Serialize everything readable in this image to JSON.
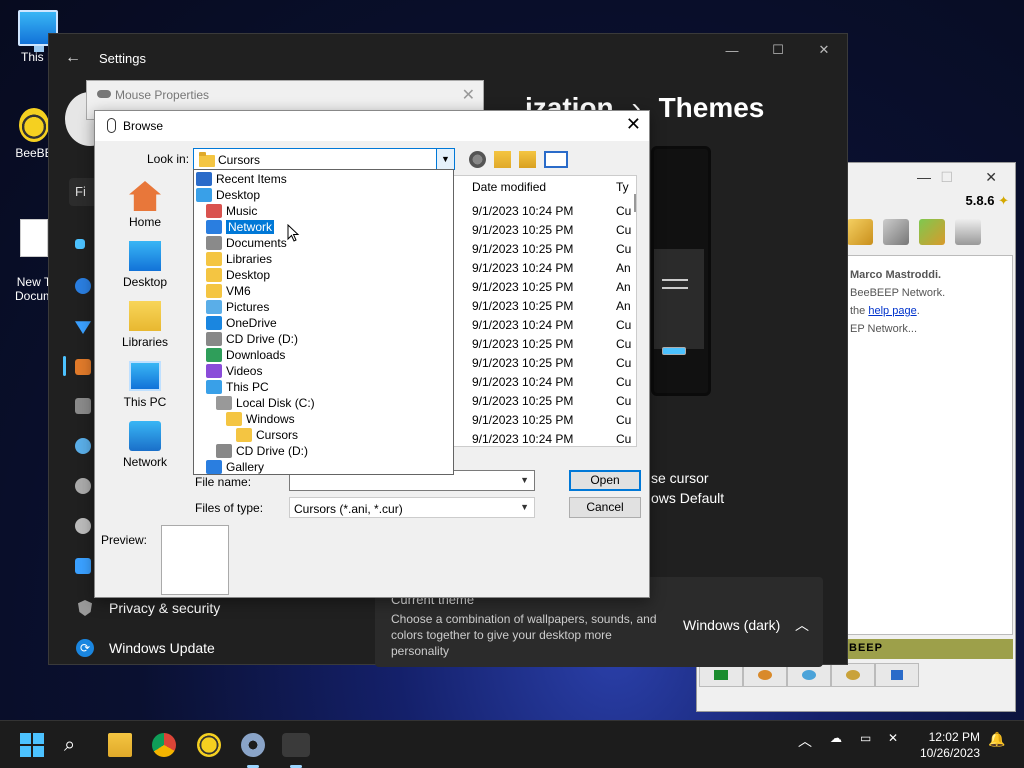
{
  "desktop": {
    "icons": [
      {
        "label": "This P"
      },
      {
        "label": "BeeBE"
      },
      {
        "label": "New T\nDocum"
      }
    ]
  },
  "settings": {
    "title": "Settings",
    "breadcrumb_partial": "ization",
    "breadcrumb_sep": "›",
    "page_title": "Themes",
    "search_partial": "Fi",
    "sidebar": [
      {
        "label": "Privacy & security"
      },
      {
        "label": "Windows Update"
      }
    ],
    "cursor_label_partial": "se cursor",
    "cursor_value_partial": "ows Default",
    "current_theme": {
      "heading": "Current theme",
      "description": "Choose a combination of wallpapers, sounds, and colors together to give your desktop more personality",
      "value": "Windows (dark)"
    }
  },
  "beebeep": {
    "version": "5.8.6",
    "chat_line1": "Marco Mastroddi.",
    "chat_line2": "BeeBEEP Network.",
    "chat_line3_pre": "the ",
    "chat_link": "help page",
    "chat_line3_post": ".",
    "chat_line4": "EP Network...",
    "beep_bar": "BEEP"
  },
  "mouse_properties": {
    "title": "Mouse Properties"
  },
  "browse": {
    "title": "Browse",
    "look_in_label": "Look in:",
    "look_in_value": "Cursors",
    "places": [
      {
        "label": "Home"
      },
      {
        "label": "Desktop"
      },
      {
        "label": "Libraries"
      },
      {
        "label": "This PC"
      },
      {
        "label": "Network"
      }
    ],
    "columns": {
      "date": "Date modified",
      "type": "Ty"
    },
    "rows": [
      {
        "date": "9/1/2023 10:24 PM",
        "type": "Cu"
      },
      {
        "date": "9/1/2023 10:25 PM",
        "type": "Cu"
      },
      {
        "date": "9/1/2023 10:25 PM",
        "type": "Cu"
      },
      {
        "date": "9/1/2023 10:24 PM",
        "type": "An"
      },
      {
        "date": "9/1/2023 10:25 PM",
        "type": "An"
      },
      {
        "date": "9/1/2023 10:25 PM",
        "type": "An"
      },
      {
        "date": "9/1/2023 10:24 PM",
        "type": "Cu"
      },
      {
        "date": "9/1/2023 10:25 PM",
        "type": "Cu"
      },
      {
        "date": "9/1/2023 10:25 PM",
        "type": "Cu"
      },
      {
        "date": "9/1/2023 10:24 PM",
        "type": "Cu"
      },
      {
        "date": "9/1/2023 10:25 PM",
        "type": "Cu"
      },
      {
        "date": "9/1/2023 10:25 PM",
        "type": "Cu"
      },
      {
        "date": "9/1/2023 10:24 PM",
        "type": "Cu"
      }
    ],
    "file_name_label": "File name:",
    "file_name_value": "",
    "files_of_type_label": "Files of type:",
    "files_of_type_value": "Cursors (*.ani, *.cur)",
    "open_label": "Open",
    "cancel_label": "Cancel",
    "preview_label": "Preview:",
    "dropdown": [
      {
        "label": "Recent Items",
        "icon": "recent-items-icon"
      },
      {
        "label": "Desktop",
        "icon": "desktop-icon"
      },
      {
        "label": "Music",
        "icon": "music-icon"
      },
      {
        "label": "Network",
        "icon": "network-icon",
        "selected": true
      },
      {
        "label": "Documents",
        "icon": "documents-icon"
      },
      {
        "label": "Libraries",
        "icon": "libraries-icon"
      },
      {
        "label": "Desktop",
        "icon": "desktop-folder-icon"
      },
      {
        "label": "VM6",
        "icon": "folder-icon"
      },
      {
        "label": "Pictures",
        "icon": "pictures-icon"
      },
      {
        "label": "OneDrive",
        "icon": "onedrive-icon"
      },
      {
        "label": "CD Drive (D:)",
        "icon": "cd-drive-icon"
      },
      {
        "label": "Downloads",
        "icon": "downloads-icon"
      },
      {
        "label": "Videos",
        "icon": "videos-icon"
      },
      {
        "label": "This PC",
        "icon": "this-pc-icon"
      },
      {
        "label": "Local Disk (C:)",
        "icon": "local-disk-icon"
      },
      {
        "label": "Windows",
        "icon": "folder-icon"
      },
      {
        "label": "Cursors",
        "icon": "folder-icon"
      },
      {
        "label": "CD Drive (D:)",
        "icon": "cd-drive-icon"
      },
      {
        "label": "Gallery",
        "icon": "gallery-icon"
      }
    ]
  },
  "taskbar": {
    "time": "12:02 PM",
    "date": "10/26/2023"
  },
  "colors": {
    "accent": "#0078d7",
    "settings_bg": "#202020"
  }
}
